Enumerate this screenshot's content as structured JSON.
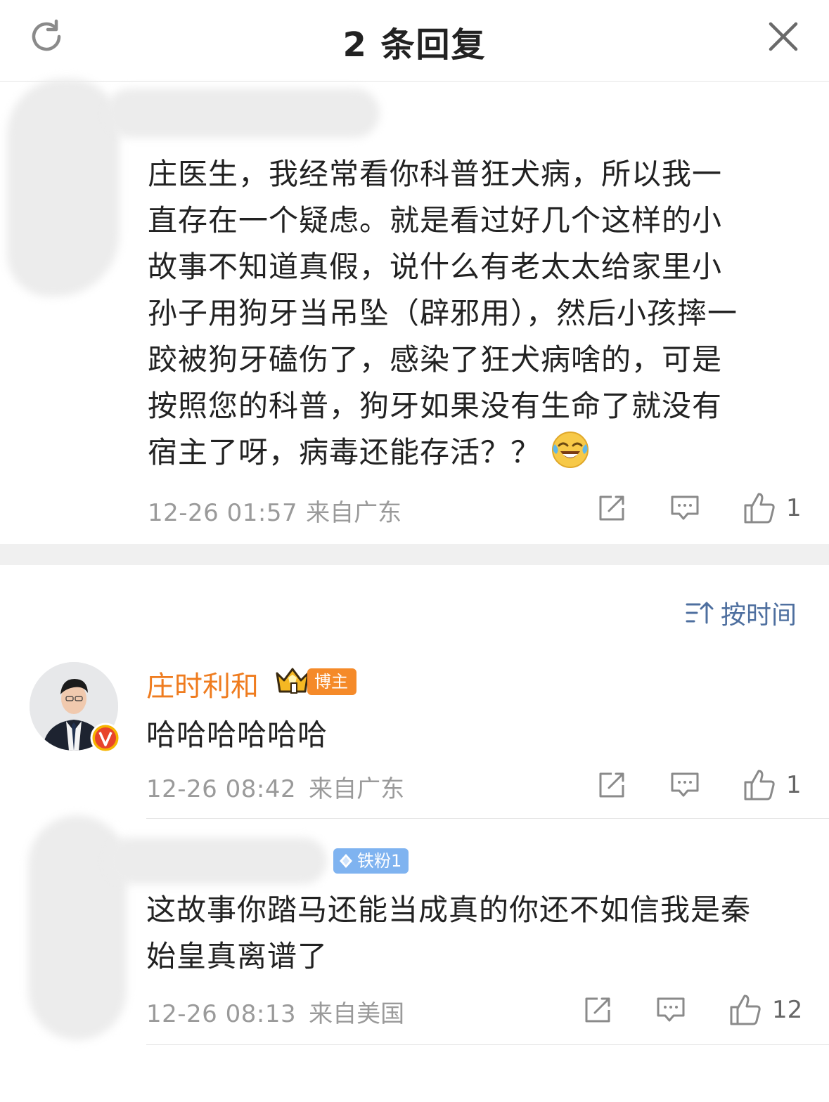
{
  "header": {
    "title": "2 条回复",
    "refresh_icon": "refresh-icon",
    "close_icon": "close-icon"
  },
  "main_comment": {
    "text": "庄医生，我经常看你科普狂犬病，所以我一直存在一个疑虑。就是看过好几个这样的小故事不知道真假，说什么有老太太给家里小孙子用狗牙当吊坠（辟邪用），然后小孩摔一跤被狗牙磕伤了，感染了狂犬病啥的，可是按照您的科普，狗牙如果没有生命了就没有宿主了呀，病毒还能存活？？",
    "lines": [
      "庄医生，我经常看你科普狂犬病，所以我一",
      "直存在一个疑虑。就是看过好几个这样的小",
      "故事不知道真假，说什么有老太太给家里小",
      "孙子用狗牙当吊坠（辟邪用），然后小孩摔一",
      "跤被狗牙磕伤了，感染了狂犬病啥的，可是",
      "按照您的科普，狗牙如果没有生命了就没有",
      "宿主了呀，病毒还能存活？？"
    ],
    "emoji": "laughing-crying-emoji",
    "time": "12-26 01:57",
    "location": "来自广东",
    "likes": "1"
  },
  "sort": {
    "label": "按时间",
    "icon": "sort-icon"
  },
  "replies": [
    {
      "username": "庄时利和",
      "badge": "博主",
      "text": "哈哈哈哈哈哈",
      "time": "12-26 08:42",
      "location": "来自广东",
      "likes": "1"
    },
    {
      "badge": "铁粉1",
      "text_lines": [
        "这故事你踏马还能当成真的你还不如信我是秦",
        "始皇真离谱了"
      ],
      "time": "12-26 08:13",
      "location": "来自美国",
      "likes": "12"
    }
  ],
  "colors": {
    "accent_orange": "#ef7c1f",
    "link_blue": "#4e6f9f",
    "meta_gray": "#9a9a9a",
    "fan_badge": "#7fb3f0"
  }
}
